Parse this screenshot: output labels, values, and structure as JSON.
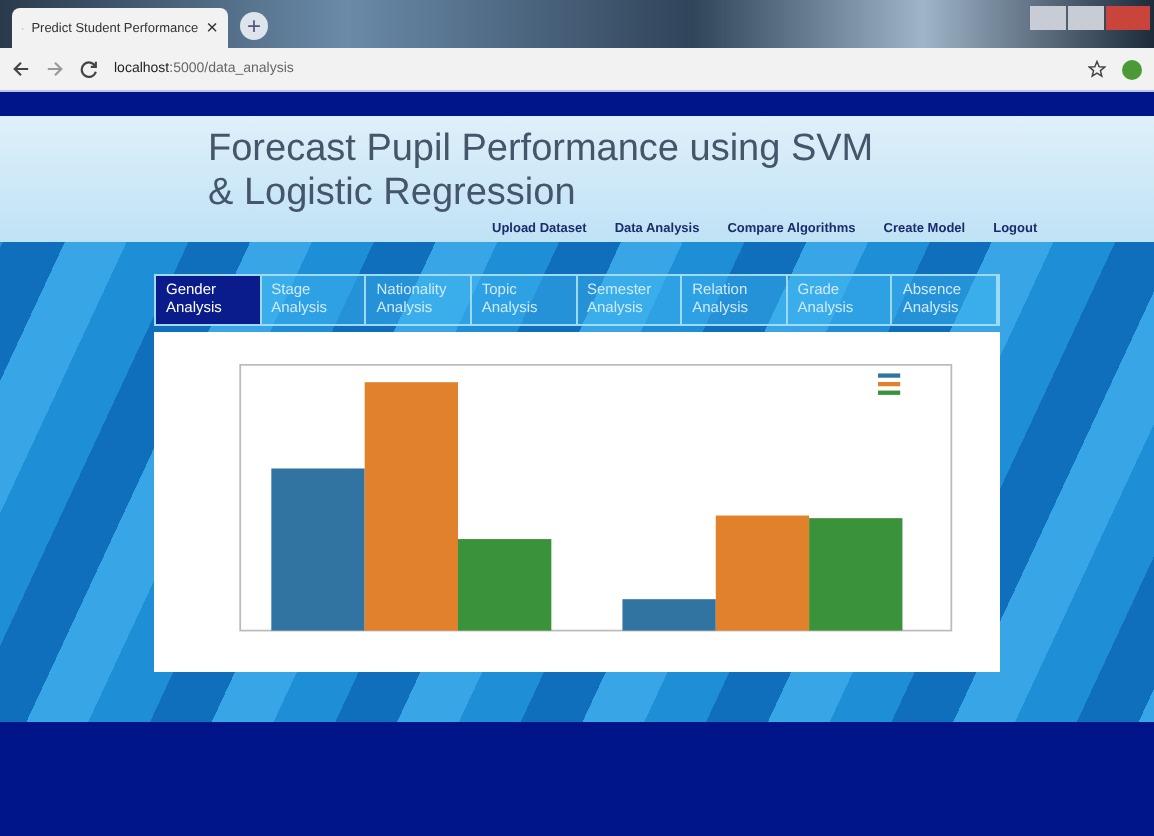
{
  "browser": {
    "tab_title": "Predict Student Performance",
    "tab_close": "×",
    "new_tab": "+",
    "url_host": "localhost",
    "url_rest": ":5000/data_analysis"
  },
  "header": {
    "title": "Forecast Pupil Performance using SVM & Logistic Regression"
  },
  "nav": [
    "Upload Dataset",
    "Data Analysis",
    "Compare Algorithms",
    "Create Model",
    "Logout"
  ],
  "tabs": [
    {
      "label": "Gender Analysis",
      "selected": true
    },
    {
      "label": "Stage Analysis",
      "selected": false
    },
    {
      "label": "Nationality Analysis",
      "selected": false
    },
    {
      "label": "Topic Analysis",
      "selected": false
    },
    {
      "label": "Semester Analysis",
      "selected": false
    },
    {
      "label": "Relation Analysis",
      "selected": false
    },
    {
      "label": "Grade Analysis",
      "selected": false
    },
    {
      "label": "Absence Analysis",
      "selected": false
    }
  ]
}
